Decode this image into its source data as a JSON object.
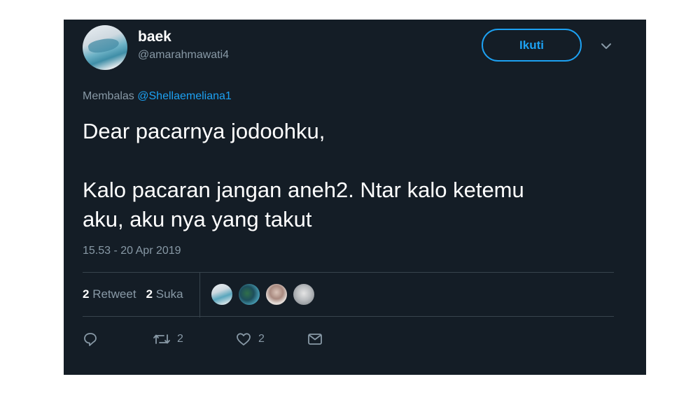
{
  "user": {
    "display_name": "baek",
    "handle": "@amarahmawati4"
  },
  "follow_label": "Ikuti",
  "reply": {
    "prefix": "Membalas",
    "mention": "@Shellaemeliana1"
  },
  "tweet": {
    "text": "Dear pacarnya jodoohku,\n\nKalo pacaran jangan aneh2. Ntar kalo ketemu\naku, aku nya yang takut",
    "timestamp": "15.53 - 20 Apr 2019"
  },
  "stats": {
    "retweet_count": "2",
    "retweet_label": "Retweet",
    "like_count": "2",
    "like_label": "Suka"
  },
  "actions": {
    "retweet_count": "2",
    "like_count": "2"
  },
  "icons": [
    "reply-icon",
    "retweet-icon",
    "heart-icon",
    "message-icon",
    "chevron-down-icon"
  ],
  "colors": {
    "background": "#141d26",
    "accent": "#1da1f2",
    "secondary_text": "#8899a6",
    "divider": "#38444d"
  }
}
